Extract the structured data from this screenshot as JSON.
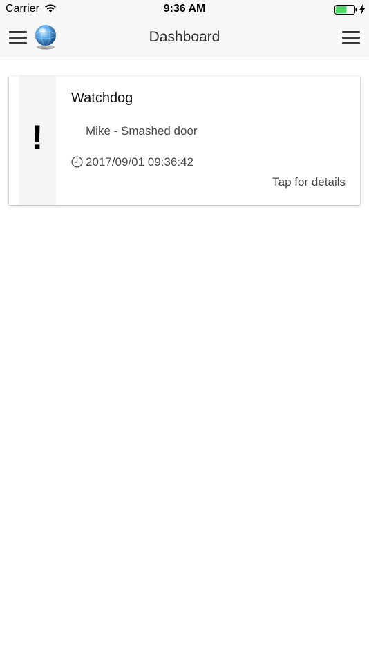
{
  "status_bar": {
    "carrier": "Carrier",
    "time": "9:36 AM",
    "wifi_icon": "wifi-icon",
    "battery_icon": "battery-icon",
    "battery_level": 0.6,
    "battery_color": "#4cd964",
    "charge_icon": "charging-bolt-icon"
  },
  "nav": {
    "title": "Dashboard",
    "left_menu_icon": "hamburger-menu-icon",
    "logo_icon": "globe-icon",
    "right_menu_icon": "hamburger-menu-icon"
  },
  "alerts": [
    {
      "mark": "!",
      "title": "Watchdog",
      "message": "Mike - Smashed door",
      "time_icon": "clock-icon",
      "timestamp": "2017/09/01 09:36:42",
      "details_label": "Tap for details"
    }
  ]
}
